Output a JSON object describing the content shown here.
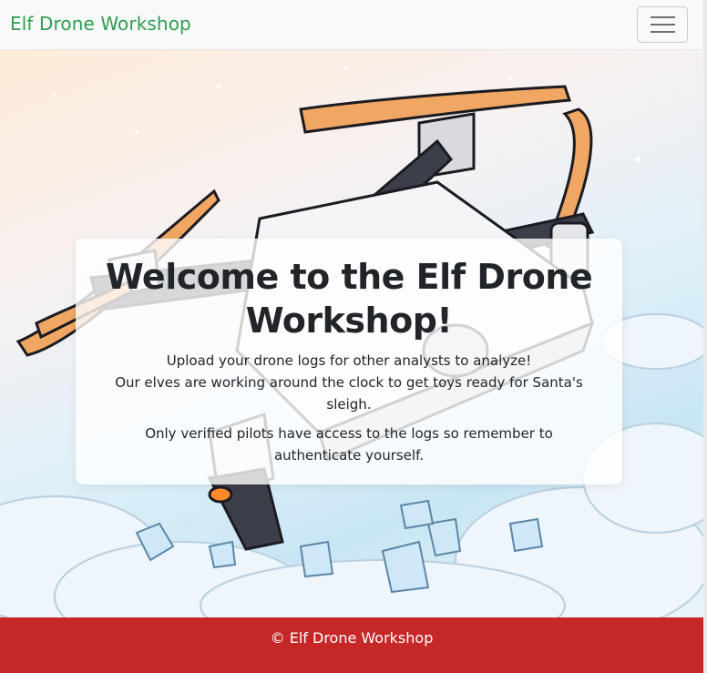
{
  "navbar": {
    "brand": "Elf Drone Workshop",
    "brand_color": "#2e9e4f",
    "toggle_icon": "hamburger-menu-icon"
  },
  "hero": {
    "background_image": "cartoon-drone-flying-over-snowy-clouds",
    "title": "Welcome to the Elf Drone Workshop!",
    "intro_line1": "Upload your drone logs for other analysts to analyze!",
    "intro_line2": "Our elves are working around the clock to get toys ready for Santa's sleigh.",
    "note": "Only verified pilots have access to the logs so remember to authenticate yourself."
  },
  "footer": {
    "text": "© Elf Drone Workshop",
    "background_color": "#c62828"
  }
}
